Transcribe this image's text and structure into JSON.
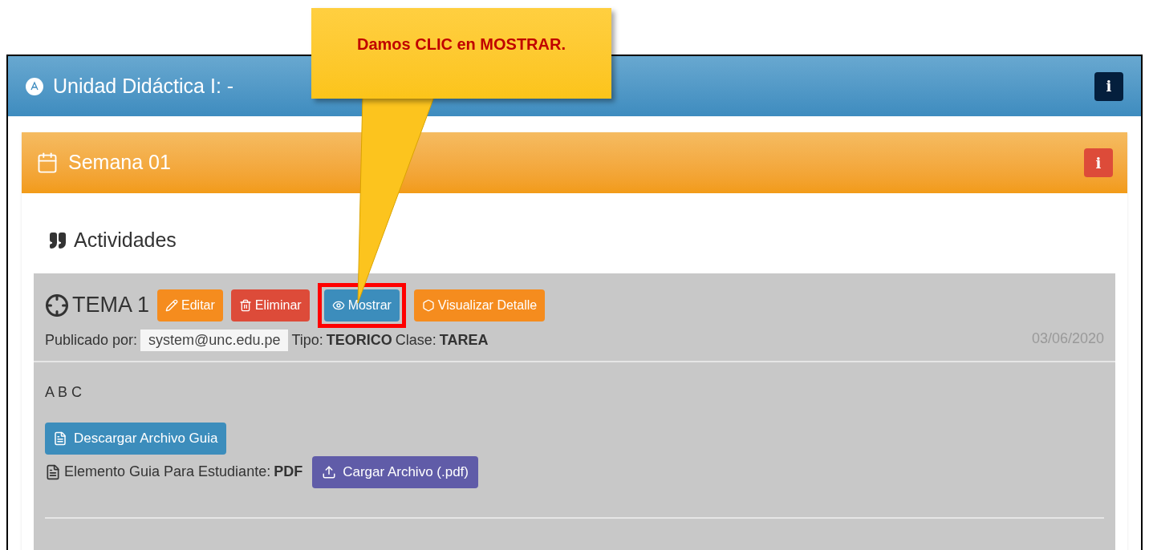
{
  "callout": {
    "text": "Damos CLIC en MOSTRAR."
  },
  "unit": {
    "title": "Unidad Didáctica I: -",
    "info_icon": "i"
  },
  "week": {
    "title": "Semana 01",
    "info_icon": "i"
  },
  "section_title": "Actividades",
  "activity": {
    "title": "TEMA 1",
    "buttons": [
      {
        "label": "Editar",
        "kind": "edit",
        "highlighted": false
      },
      {
        "label": "Eliminar",
        "kind": "delete",
        "highlighted": false
      },
      {
        "label": "Mostrar",
        "kind": "show",
        "highlighted": true
      },
      {
        "label": "Visualizar Detalle",
        "kind": "detail",
        "highlighted": false
      }
    ],
    "published_label": "Publicado por:",
    "publisher": "system@unc.edu.pe",
    "type_label": "Tipo:",
    "type": "TEORICO",
    "class_label": "Clase:",
    "class": "TAREA",
    "date": "03/06/2020",
    "description": "A B C",
    "download_button": "Descargar Archivo Guia",
    "element_label": "Elemento Guia Para Estudiante:",
    "element_format": "PDF",
    "upload_button": "Cargar Archivo (.pdf)"
  }
}
